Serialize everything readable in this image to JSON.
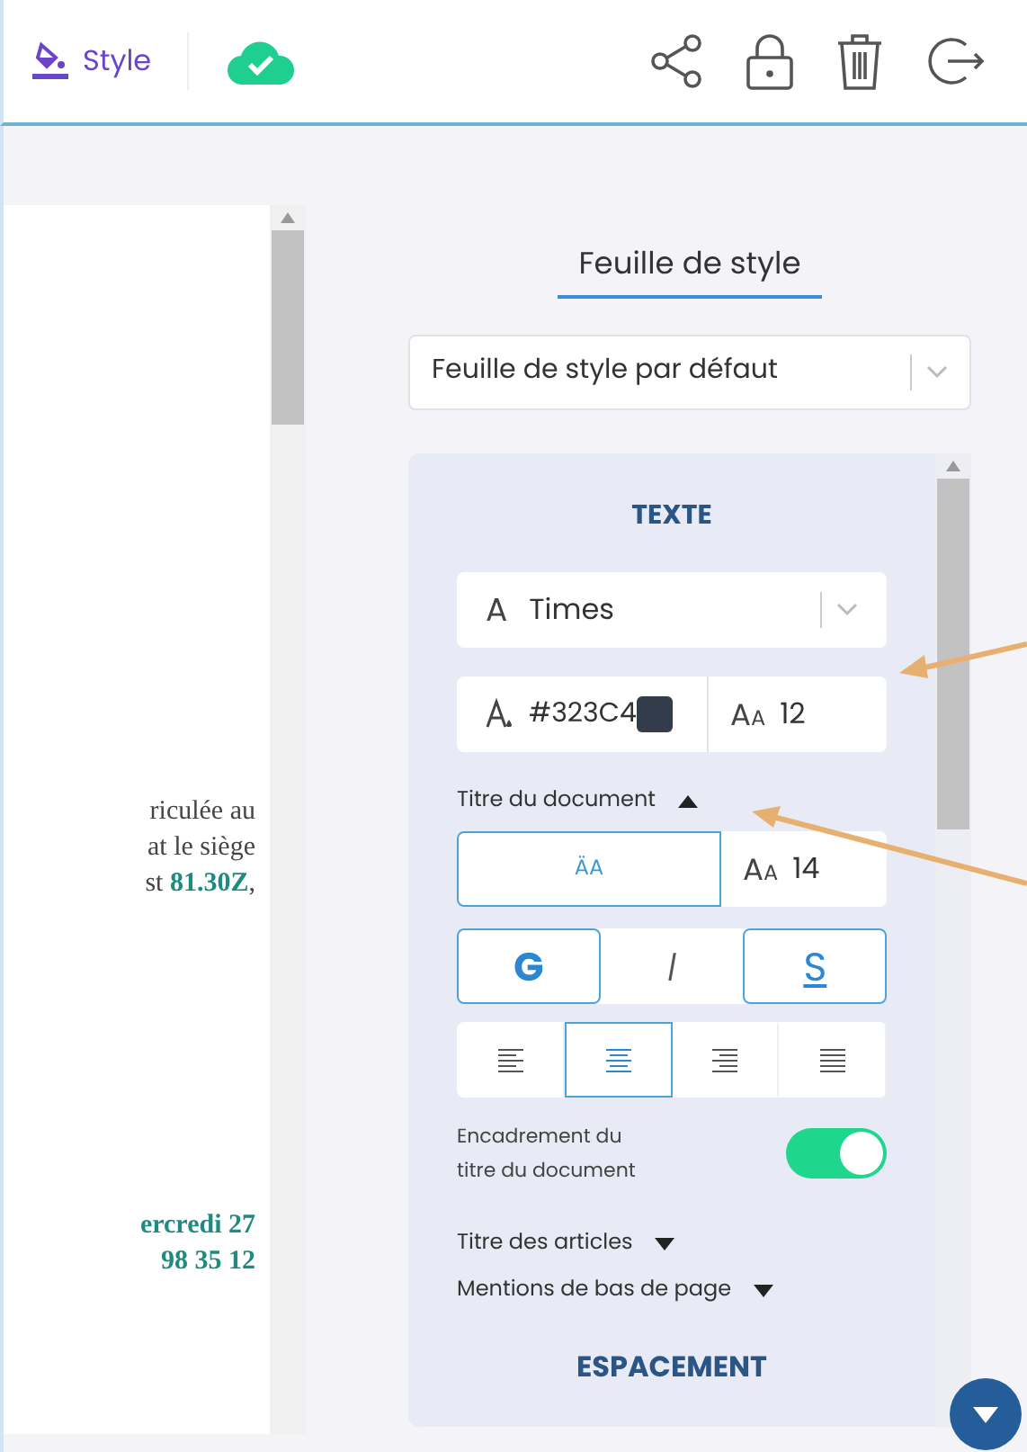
{
  "toolbar": {
    "style_tab": {
      "label": "Style",
      "selected": true
    }
  },
  "document": {
    "lines": [
      {
        "text": "riculée au",
        "emphasis": false
      },
      {
        "text": "at le siège",
        "emphasis": false
      },
      {
        "text": "st **81.30Z**,",
        "emphasis": false
      },
      {
        "text": "ercredi 27",
        "emphasis": true
      },
      {
        "text": "98 35 12",
        "emphasis": true
      }
    ]
  },
  "panel": {
    "title": "Feuille de style",
    "stylesheet_select": {
      "value": "Feuille de style par défaut"
    },
    "sections": [
      {
        "title": "TEXTE",
        "font_select": {
          "icon": "A",
          "value": "Times"
        },
        "color_field": {
          "value": "#323C4",
          "color": "#323c4a"
        },
        "size_field": {
          "icon": "AA",
          "value": "12"
        },
        "groups": [
          {
            "label": "Titre du document",
            "expanded": true,
            "case_button": {
              "label": "ÄA",
              "selected": true
            },
            "size_field": {
              "icon": "AA",
              "value": "14"
            },
            "format_buttons": [
              {
                "label": "G",
                "selected": true
              },
              {
                "label": "I",
                "selected": false
              },
              {
                "label": "S",
                "selected": true
              }
            ],
            "align_buttons": [
              {
                "kind": "left",
                "selected": false
              },
              {
                "kind": "center",
                "selected": true
              },
              {
                "kind": "right",
                "selected": false
              },
              {
                "kind": "justify",
                "selected": false
              }
            ],
            "toggle": {
              "label": "Encadrement du titre du document",
              "on": true
            }
          },
          {
            "label": "Titre des articles",
            "expanded": false
          },
          {
            "label": "Mentions de bas de page",
            "expanded": false
          }
        ]
      },
      {
        "title": "ESPACEMENT"
      }
    ]
  }
}
